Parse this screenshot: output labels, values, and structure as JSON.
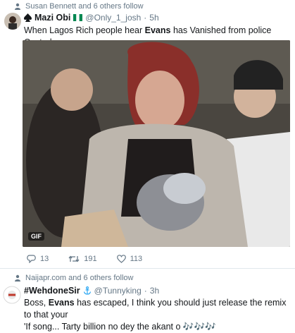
{
  "tweet1": {
    "social_context": "Susan Bennett and 6 others follow",
    "display_name": "Mazi Obi",
    "handle": "@Only_1_josh",
    "separator": "·",
    "time": "5h",
    "text_before": "When Lagos Rich people hear ",
    "text_bold": "Evans",
    "text_after": " has Vanished from police Custody",
    "media_badge": "GIF",
    "replies": "13",
    "retweets": "191",
    "likes": "113"
  },
  "tweet2": {
    "social_context": "Naijapr.com and 6 others follow",
    "display_name": "#WehdoneSir",
    "handle": "@Tunnyking",
    "separator": "·",
    "time": "3h",
    "line1_a": "Boss, ",
    "line1_bold": "Evans",
    "line1_b": " has escaped, I think you should just release the remix to that your",
    "line2": "'If song... Tarty billion no dey the akant o ",
    "notes": "🎶🎶🎶"
  },
  "colors": {
    "muted": "#657786",
    "text": "#14171a",
    "divider": "#e1e8ed",
    "link": "#1da1f2"
  },
  "icons": [
    "person-icon",
    "spade-icon",
    "nigeria-flag-icon",
    "reply-icon",
    "retweet-icon",
    "like-icon",
    "anchor-icon",
    "music-notes-icon"
  ]
}
